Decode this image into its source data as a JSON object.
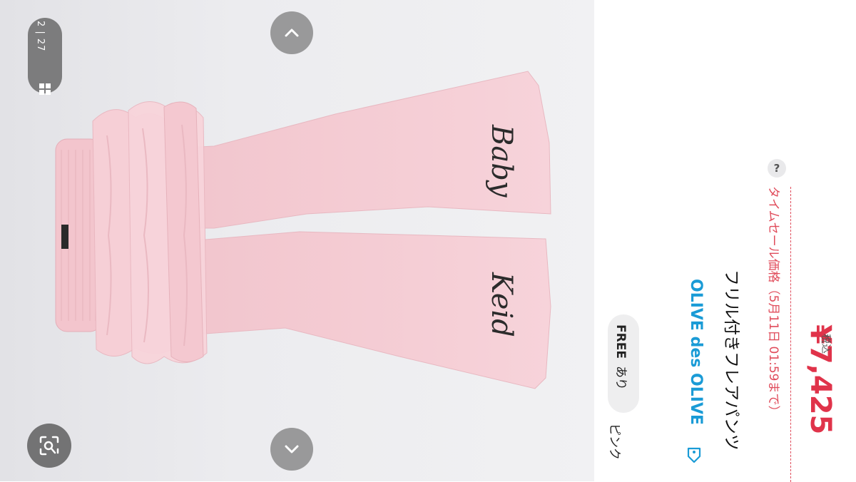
{
  "gallery": {
    "counter": "2 | 27",
    "icons": {
      "grid": "grid-icon",
      "up": "chevron-up-icon",
      "down": "chevron-down-icon",
      "lens": "image-search-icon"
    },
    "printed_text": [
      "Baby",
      "Keid"
    ]
  },
  "product": {
    "color": "ピンク",
    "size": "FREE",
    "stock": "あり",
    "brand": "OLIVE des OLIVE",
    "title": "フリル付きフレアパンツ",
    "sale_label": "タイムセール価格（5月11日 01:59まで）",
    "help": "?",
    "price": "¥7,425",
    "tax_label": "税込"
  },
  "colors": {
    "brand": "#1a9bd6",
    "price": "#e0334a",
    "sale": "#e04b5a",
    "garment": "#f5cbd3"
  }
}
